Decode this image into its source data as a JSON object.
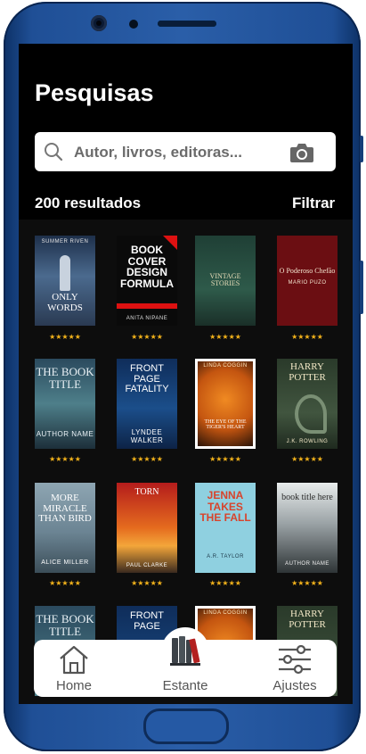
{
  "header": {
    "title": "Pesquisas"
  },
  "search": {
    "placeholder": "Autor, livros, editoras..."
  },
  "results": {
    "count_label": "200 resultados",
    "filter_label": "Filtrar"
  },
  "rating_stars": "★★★★★",
  "books": [
    {
      "title": "ONLY WORDS",
      "author": "SUMMER RIVEN"
    },
    {
      "title": "BOOK COVER DESIGN FORMULA",
      "author": "ANITA NIPANE"
    },
    {
      "title": "VINTAGE STORIES",
      "author": ""
    },
    {
      "title": "O Poderoso Chefão",
      "author": "MARIO PUZO"
    },
    {
      "title": "THE BOOK TITLE",
      "author": "AUTHOR NAME"
    },
    {
      "title": "FRONT PAGE FATALITY",
      "author": "LYNDEE WALKER"
    },
    {
      "title": "THE EYE OF THE TIGER'S HEART",
      "author": "LINDA COGGIN"
    },
    {
      "title": "HARRY POTTER",
      "author": "J.K. ROWLING"
    },
    {
      "title": "MORE MIRACLE THAN BIRD",
      "author": "ALICE MILLER"
    },
    {
      "title": "TORN",
      "author": "PAUL CLARKE"
    },
    {
      "title": "JENNA TAKES THE FALL",
      "author": "A.R. TAYLOR"
    },
    {
      "title": "book title here",
      "author": "AUTHOR NAME"
    },
    {
      "title": "THE BOOK TITLE",
      "author": ""
    },
    {
      "title": "FRONT PAGE",
      "author": ""
    },
    {
      "title": "",
      "author": "LINDA COGGIN"
    },
    {
      "title": "HARRY POTTER",
      "author": ""
    }
  ],
  "tabs": [
    {
      "label": "Home",
      "icon": "home-icon"
    },
    {
      "label": "Estante",
      "icon": "bookshelf-icon"
    },
    {
      "label": "Ajustes",
      "icon": "sliders-icon"
    }
  ],
  "colors": {
    "star": "#f2b21b",
    "frame": "#1f4f96",
    "background": "#000000"
  }
}
